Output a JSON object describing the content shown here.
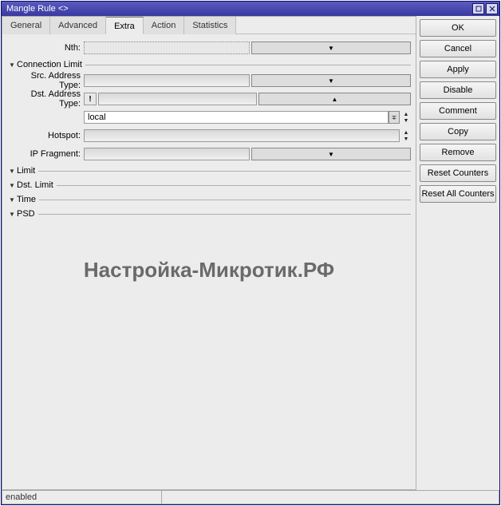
{
  "window": {
    "title": "Mangle Rule <>"
  },
  "tabs": {
    "items": [
      {
        "label": "General"
      },
      {
        "label": "Advanced"
      },
      {
        "label": "Extra"
      },
      {
        "label": "Action"
      },
      {
        "label": "Statistics"
      }
    ],
    "active": 2
  },
  "form": {
    "nth_label": "Nth:",
    "nth_value": "",
    "connection_limit_label": "Connection Limit",
    "src_address_type_label": "Src. Address Type:",
    "src_address_type_value": "",
    "dst_address_type_label": "Dst. Address Type:",
    "dst_address_type_negate": "!",
    "dst_address_type_value": "",
    "dst_address_type_value2": "local",
    "hotspot_label": "Hotspot:",
    "hotspot_value": "",
    "ip_fragment_label": "IP Fragment:",
    "ip_fragment_value": "",
    "limit_label": "Limit",
    "dst_limit_label": "Dst. Limit",
    "time_label": "Time",
    "psd_label": "PSD"
  },
  "buttons": {
    "ok": "OK",
    "cancel": "Cancel",
    "apply": "Apply",
    "disable": "Disable",
    "comment": "Comment",
    "copy": "Copy",
    "remove": "Remove",
    "reset_counters": "Reset Counters",
    "reset_all_counters": "Reset All Counters"
  },
  "status": {
    "text": "enabled"
  },
  "watermark": "Настройка-Микротик.РФ"
}
